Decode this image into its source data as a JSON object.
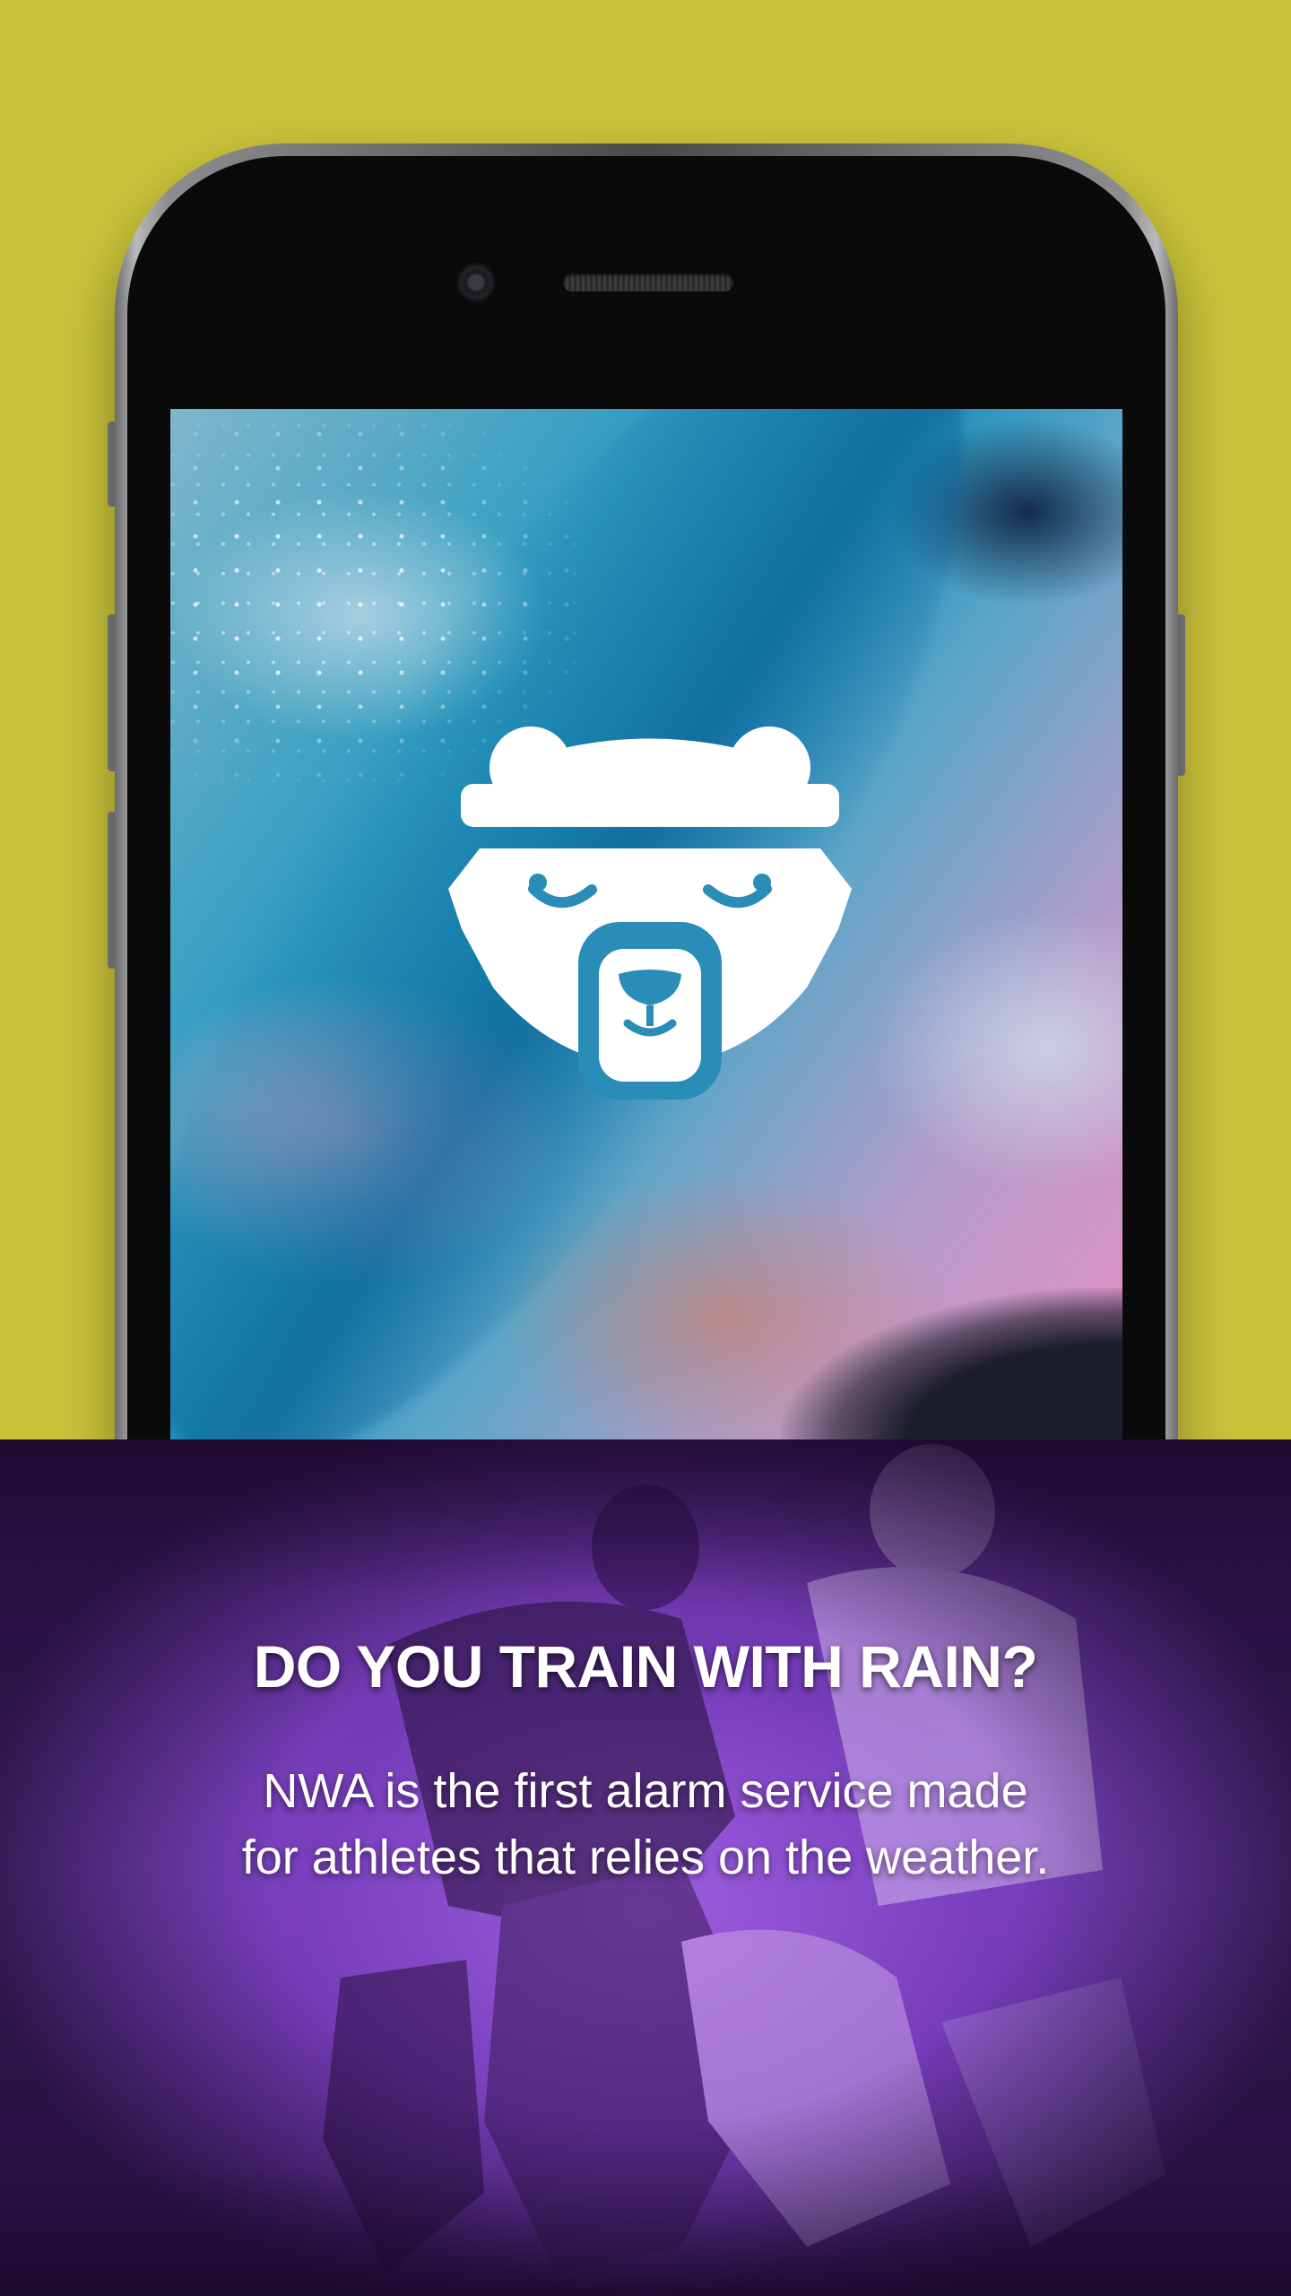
{
  "background_color": "#c9c23a",
  "app": {
    "logo_icon": "bear-headband-icon"
  },
  "promo": {
    "headline": "DO YOU TRAIN WITH RAIN?",
    "body_line_1": "NWA is the first alarm service made",
    "body_line_2": "for athletes that relies on the weather.",
    "panel_color": "#7a44bd"
  }
}
